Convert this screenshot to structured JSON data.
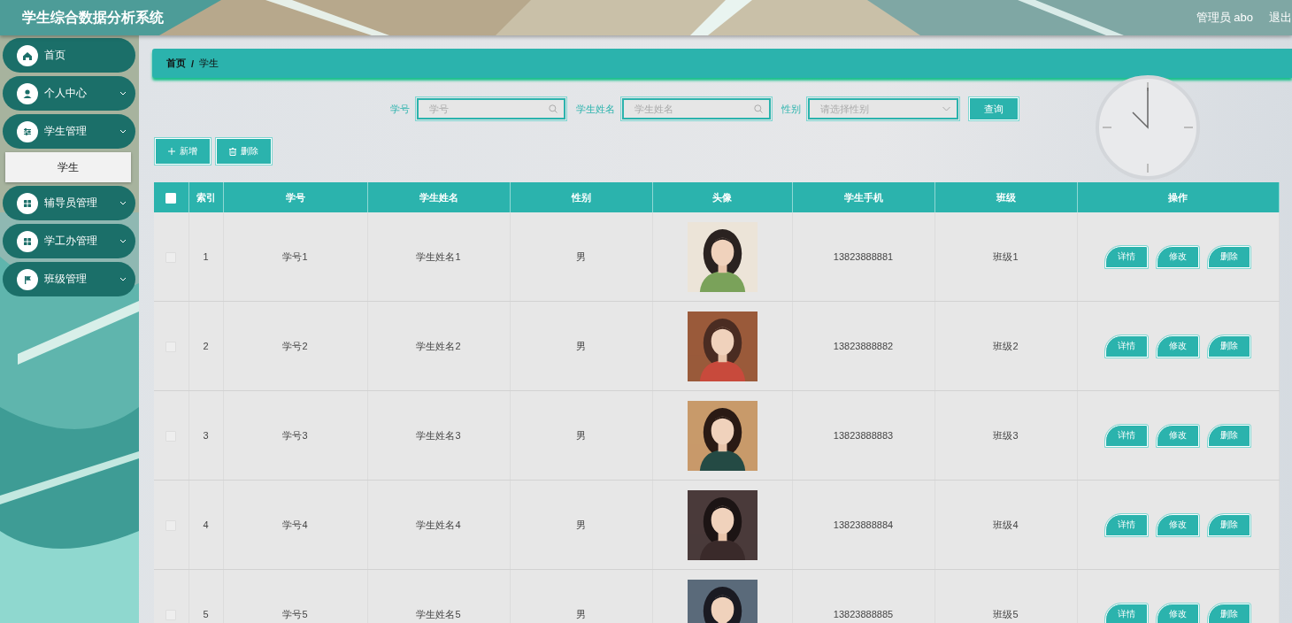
{
  "header": {
    "title": "学生综合数据分析系统",
    "user": "管理员 abo",
    "logout": "退出"
  },
  "sidebar": {
    "items": [
      {
        "label": "首页",
        "expandable": false
      },
      {
        "label": "个人中心",
        "expandable": true
      },
      {
        "label": "学生管理",
        "expandable": true,
        "children": [
          {
            "label": "学生",
            "selected": true
          }
        ]
      },
      {
        "label": "辅导员管理",
        "expandable": true
      },
      {
        "label": "学工办管理",
        "expandable": true
      },
      {
        "label": "班级管理",
        "expandable": true
      }
    ]
  },
  "breadcrumb": {
    "items": [
      "首页",
      "学生"
    ],
    "separator": "/"
  },
  "search": {
    "fields": [
      {
        "label": "学号",
        "placeholder": "学号",
        "kind": "text"
      },
      {
        "label": "学生姓名",
        "placeholder": "学生姓名",
        "kind": "text"
      },
      {
        "label": "性别",
        "placeholder": "请选择性别",
        "kind": "select"
      }
    ],
    "button": "查询"
  },
  "toolbar": [
    {
      "label": "新增",
      "kind": "add"
    },
    {
      "label": "删除",
      "kind": "delete"
    }
  ],
  "table": {
    "header_checked": false,
    "columns": [
      "索引",
      "学号",
      "学生姓名",
      "性别",
      "头像",
      "学生手机",
      "班级",
      "操作"
    ],
    "rows": [
      {
        "checked": false,
        "cells": [
          "1",
          "学号1",
          "学生姓名1",
          "男"
        ],
        "avatar": {
          "kind": "picture"
        },
        "tail": [
          "13823888881",
          "班级1"
        ],
        "actions": [
          "详情",
          "修改",
          "删除"
        ]
      },
      {
        "checked": false,
        "cells": [
          "2",
          "学号2",
          "学生姓名2",
          "男"
        ],
        "avatar": {
          "kind": "picture"
        },
        "tail": [
          "13823888882",
          "班级2"
        ],
        "actions": [
          "详情",
          "修改",
          "删除"
        ]
      },
      {
        "checked": false,
        "cells": [
          "3",
          "学号3",
          "学生姓名3",
          "男"
        ],
        "avatar": {
          "kind": "picture"
        },
        "tail": [
          "13823888883",
          "班级3"
        ],
        "actions": [
          "详情",
          "修改",
          "删除"
        ]
      },
      {
        "checked": false,
        "cells": [
          "4",
          "学号4",
          "学生姓名4",
          "男"
        ],
        "avatar": {
          "kind": "picture"
        },
        "tail": [
          "13823888884",
          "班级4"
        ],
        "actions": [
          "详情",
          "修改",
          "删除"
        ]
      },
      {
        "checked": false,
        "cells": [
          "5",
          "学号5",
          "学生姓名5",
          "男"
        ],
        "avatar": {
          "kind": "picture"
        },
        "tail": [
          "13823888885",
          "班级5"
        ],
        "actions": [
          "详情",
          "修改",
          "删除"
        ]
      }
    ]
  }
}
